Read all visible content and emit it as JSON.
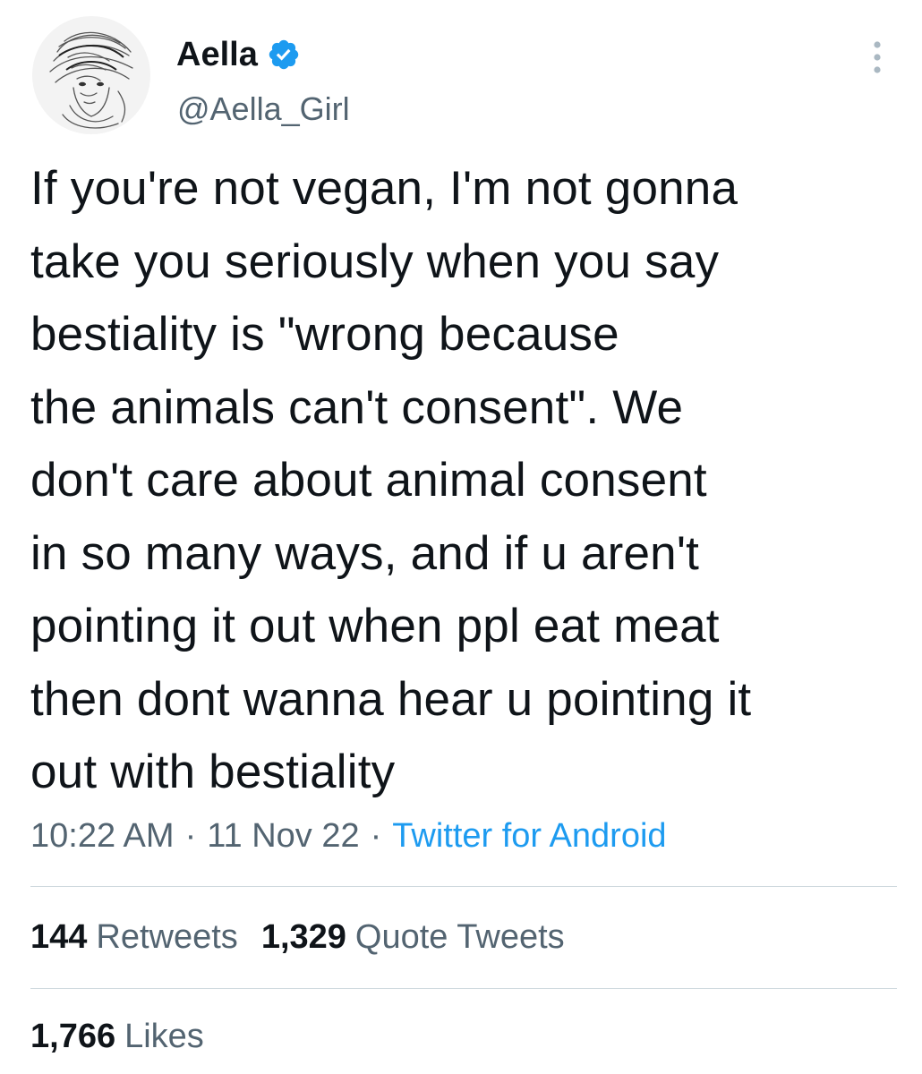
{
  "author": {
    "display_name": "Aella",
    "handle": "@Aella_Girl",
    "verified": true,
    "avatar_icon": "sketch-portrait-avatar"
  },
  "tweet": {
    "text": "If you're not vegan, I'm not gonna\ntake you seriously when you say\nbestiality is \"wrong because\nthe animals can't consent\". We\ndon't care about animal consent\nin so many ways, and if u aren't\npointing it out when ppl eat meat\nthen dont wanna hear u pointing it\nout with bestiality",
    "time": "10:22 AM",
    "date": "11 Nov 22",
    "separator": "·",
    "source": "Twitter for Android"
  },
  "stats": {
    "retweets_count": "144",
    "retweets_label": "Retweets",
    "quotes_count": "1,329",
    "quotes_label": "Quote Tweets",
    "likes_count": "1,766",
    "likes_label": "Likes"
  },
  "colors": {
    "text": "#0f1419",
    "secondary": "#536471",
    "link": "#1d9bf0",
    "divider": "#cfd9de"
  },
  "icons": {
    "verified": "verified-badge-icon",
    "more": "more-vertical-icon"
  }
}
